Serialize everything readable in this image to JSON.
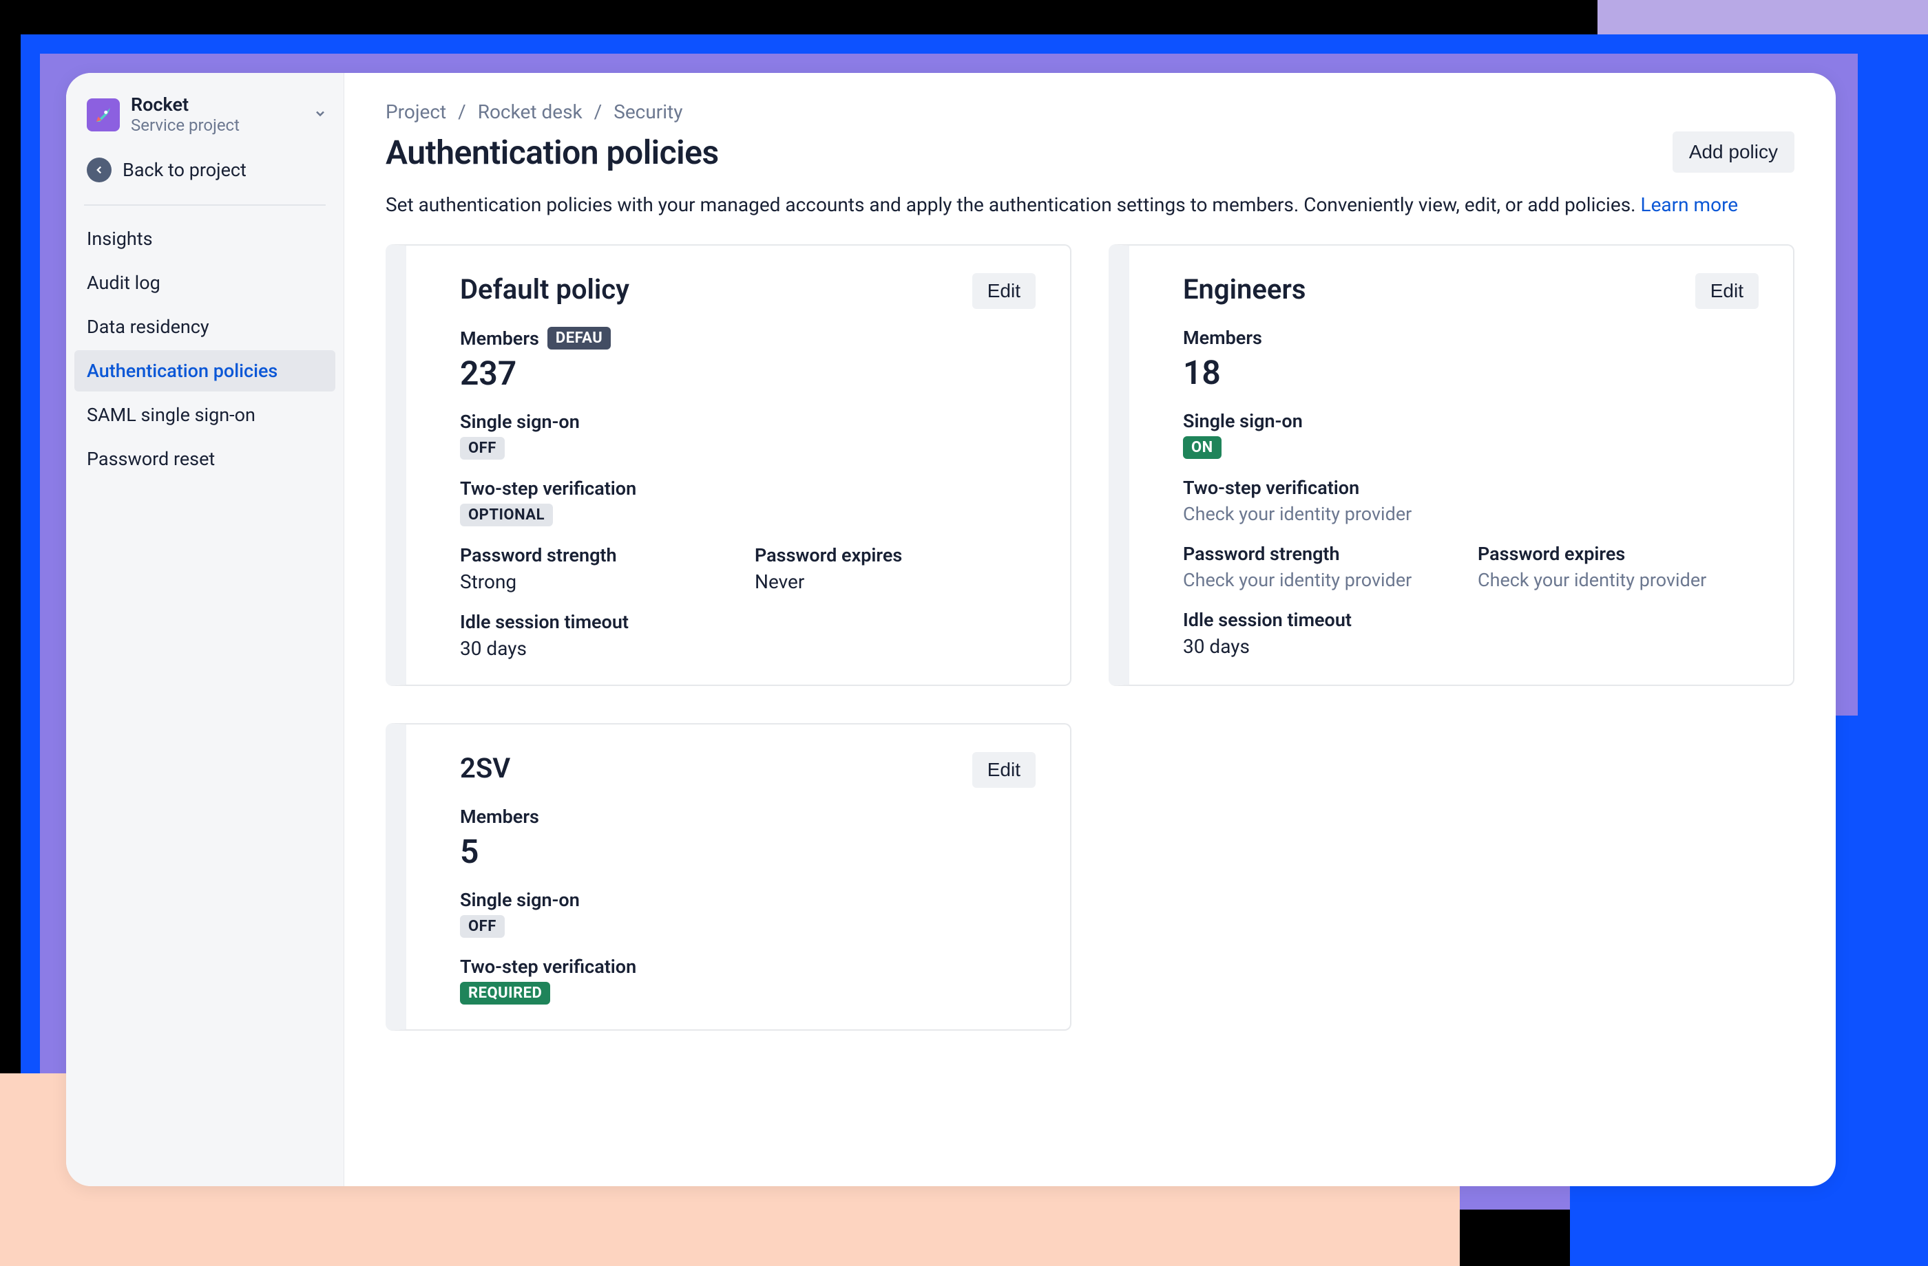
{
  "project": {
    "name": "Rocket",
    "subtitle": "Service project"
  },
  "back_link": "Back to project",
  "sidebar": {
    "items": [
      {
        "label": "Insights"
      },
      {
        "label": "Audit log"
      },
      {
        "label": "Data residency"
      },
      {
        "label": "Authentication policies"
      },
      {
        "label": "SAML single sign-on"
      },
      {
        "label": "Password reset"
      }
    ]
  },
  "breadcrumb": {
    "a": "Project",
    "b": "Rocket desk",
    "c": "Security"
  },
  "page": {
    "title": "Authentication policies",
    "description": "Set authentication policies with your managed accounts and apply the authentication settings to members. Conveniently view, edit, or add policies. ",
    "learn_more": "Learn more",
    "add_button": "Add policy"
  },
  "labels": {
    "edit": "Edit",
    "members": "Members",
    "sso": "Single sign-on",
    "tsv": "Two-step verification",
    "pw_strength": "Password strength",
    "pw_expires": "Password expires",
    "idle": "Idle session timeout",
    "check_idp": "Check your identity provider"
  },
  "badges": {
    "default": "DEFAU",
    "off": "OFF",
    "on": "ON",
    "optional": "OPTIONAL",
    "required": "REQUIRED"
  },
  "policies": {
    "default": {
      "title": "Default policy",
      "members": "237",
      "pw_strength": "Strong",
      "pw_expires": "Never",
      "idle": "30 days"
    },
    "engineers": {
      "title": "Engineers",
      "members": "18",
      "idle": "30 days"
    },
    "tsv": {
      "title": "2SV",
      "members": "5"
    }
  }
}
